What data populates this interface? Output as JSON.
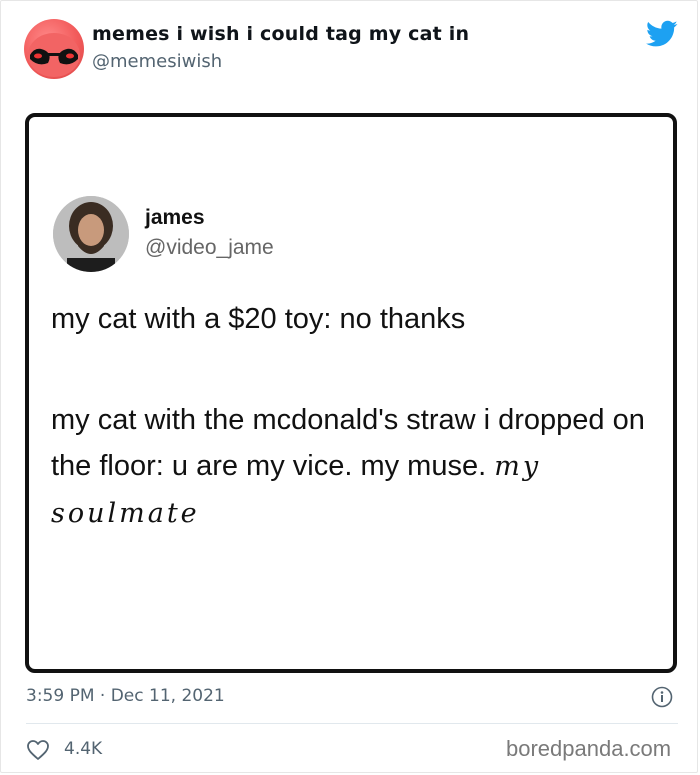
{
  "tweet": {
    "author_name": "memes i wish i could tag my cat in",
    "author_handle": "@memesiwish",
    "timestamp": "3:59 PM · Dec 11, 2021",
    "likes": "4.4K"
  },
  "embedded": {
    "name": "james",
    "handle": "@video_jame",
    "line1": "my cat with a $20 toy: no thanks",
    "line2": "my cat with the mcdonald's straw i dropped on the floor: u are my vice. my muse.",
    "line2_cursive": "my soulmate"
  },
  "watermark": "boredpanda.com",
  "colors": {
    "twitter_blue": "#1da1f2",
    "secondary_text": "#536471",
    "avatar_red": "#f25b5b"
  },
  "icons": {
    "bird": "twitter-bird-icon",
    "info": "info-icon",
    "heart": "heart-icon"
  }
}
